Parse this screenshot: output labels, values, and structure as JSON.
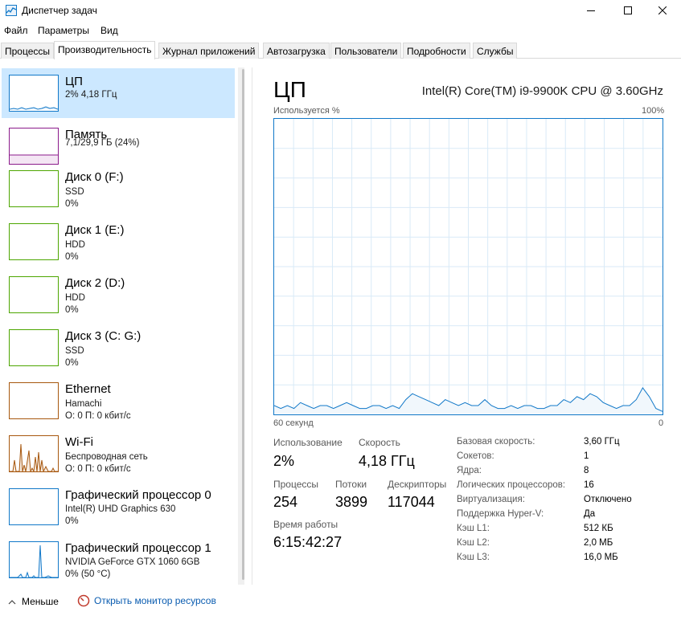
{
  "window": {
    "title": "Диспетчер задач"
  },
  "menu": [
    "Файл",
    "Параметры",
    "Вид"
  ],
  "tabs": [
    {
      "label": "Процессы",
      "active": false
    },
    {
      "label": "Производительность",
      "active": true
    },
    {
      "label": "Журнал приложений",
      "active": false
    },
    {
      "label": "Автозагрузка",
      "active": false
    },
    {
      "label": "Пользователи",
      "active": false
    },
    {
      "label": "Подробности",
      "active": false
    },
    {
      "label": "Службы",
      "active": false
    }
  ],
  "sidebar": {
    "items": [
      {
        "title": "ЦП",
        "sub1": "2% 4,18 ГГц",
        "sub2": "",
        "color": "#1178c8",
        "selected": true
      },
      {
        "title": "Память",
        "sub1": "7,1/29,9 ГБ (24%)",
        "sub2": "",
        "color": "#8b1a8b",
        "selected": false
      },
      {
        "title": "Диск 0 (F:)",
        "sub1": "SSD",
        "sub2": "0%",
        "color": "#4da600",
        "selected": false
      },
      {
        "title": "Диск 1 (E:)",
        "sub1": "HDD",
        "sub2": "0%",
        "color": "#4da600",
        "selected": false
      },
      {
        "title": "Диск 2 (D:)",
        "sub1": "HDD",
        "sub2": "0%",
        "color": "#4da600",
        "selected": false
      },
      {
        "title": "Диск 3 (C: G:)",
        "sub1": "SSD",
        "sub2": "0%",
        "color": "#4da600",
        "selected": false
      },
      {
        "title": "Ethernet",
        "sub1": "Hamachi",
        "sub2": "О: 0 П: 0 кбит/с",
        "color": "#a7570e",
        "selected": false
      },
      {
        "title": "Wi-Fi",
        "sub1": "Беспроводная сеть",
        "sub2": "О: 0 П: 0 кбит/с",
        "color": "#a7570e",
        "selected": false
      },
      {
        "title": "Графический процессор 0",
        "sub1": "Intel(R) UHD Graphics 630",
        "sub2": "0%",
        "color": "#1178c8",
        "selected": false
      },
      {
        "title": "Графический процессор 1",
        "sub1": "NVIDIA GeForce GTX 1060 6GB",
        "sub2": "0% (50 °C)",
        "color": "#1178c8",
        "selected": false
      }
    ]
  },
  "main": {
    "title": "ЦП",
    "cpu_name": "Intel(R) Core(TM) i9-9900K CPU @ 3.60GHz",
    "graph_top_left": "Используется %",
    "graph_top_right": "100%",
    "graph_bottom_left": "60 секунд",
    "graph_bottom_right": "0",
    "stats": {
      "usage_label": "Использование",
      "usage_value": "2%",
      "speed_label": "Скорость",
      "speed_value": "4,18 ГГц",
      "processes_label": "Процессы",
      "processes_value": "254",
      "threads_label": "Потоки",
      "threads_value": "3899",
      "handles_label": "Дескрипторы",
      "handles_value": "117044",
      "uptime_label": "Время работы",
      "uptime_value": "6:15:42:27"
    },
    "details": [
      {
        "key": "Базовая скорость:",
        "value": "3,60 ГГц"
      },
      {
        "key": "Сокетов:",
        "value": "1"
      },
      {
        "key": "Ядра:",
        "value": "8"
      },
      {
        "key": "Логических процессоров:",
        "value": "16"
      },
      {
        "key": "Виртуализация:",
        "value": "Отключено"
      },
      {
        "key": "Поддержка Hyper-V:",
        "value": "Да"
      },
      {
        "key": "Кэш L1:",
        "value": "512 КБ"
      },
      {
        "key": "Кэш L2:",
        "value": "2,0 МБ"
      },
      {
        "key": "Кэш L3:",
        "value": "16,0 МБ"
      }
    ],
    "cpu_history_percent": [
      3,
      2,
      3,
      2,
      4,
      3,
      2,
      3,
      3,
      2,
      3,
      4,
      3,
      2,
      2,
      3,
      3,
      2,
      3,
      2,
      5,
      7,
      6,
      5,
      4,
      3,
      5,
      4,
      3,
      4,
      3,
      3,
      5,
      3,
      2,
      2,
      3,
      2,
      3,
      3,
      2,
      2,
      3,
      3,
      5,
      4,
      6,
      5,
      7,
      6,
      4,
      3,
      2,
      3,
      3,
      5,
      9,
      6,
      2,
      1
    ]
  },
  "footer": {
    "fewer_label": "Меньше",
    "resmon_label": "Открыть монитор ресурсов"
  }
}
